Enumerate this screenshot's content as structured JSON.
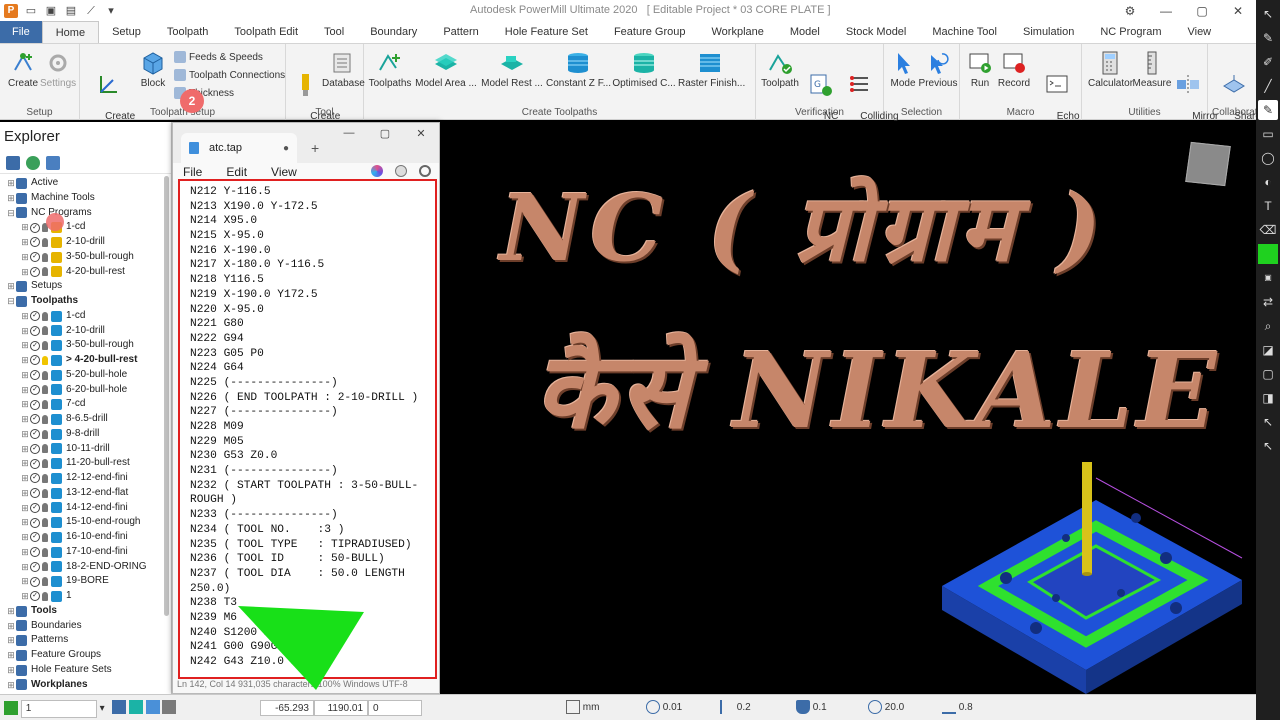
{
  "window": {
    "title": "Autodesk PowerMill Ultimate 2020",
    "project": "[ Editable Project * 03 CORE PLATE ]"
  },
  "ribbon": {
    "tabs": [
      "File",
      "Home",
      "Setup",
      "Toolpath",
      "Toolpath Edit",
      "Tool",
      "Boundary",
      "Pattern",
      "Hole Feature Set",
      "Feature Group",
      "Workplane",
      "Model",
      "Stock Model",
      "Machine Tool",
      "Simulation",
      "NC Program",
      "View"
    ],
    "active_tab": "Home",
    "groups": {
      "setup": {
        "label": "Setup",
        "create": "Create",
        "settings": "Settings"
      },
      "toolpath_setup": {
        "label": "Toolpath setup",
        "create_workplane": "Create\nWorkplane",
        "block": "Block",
        "feeds_speeds": "Feeds & Speeds",
        "toolpath_connections": "Toolpath Connections",
        "thickness": "Thickness"
      },
      "tool": {
        "label": "Tool",
        "create_tool": "Create\nTool",
        "database": "Database"
      },
      "create_toolpaths": {
        "label": "Create Toolpaths",
        "toolpaths": "Toolpaths",
        "model_area": "Model Area ...",
        "model_rest": "Model Rest ...",
        "constant_z": "Constant Z F...",
        "optimised": "Optimised C...",
        "raster_finish": "Raster Finish..."
      },
      "verification": {
        "label": "Verification",
        "toolpath": "Toolpath",
        "nc_program": "NC\nProgram",
        "colliding_sections": "Colliding\nSections"
      },
      "selection": {
        "label": "Selection",
        "mode": "Mode",
        "previous": "Previous"
      },
      "macro": {
        "label": "Macro",
        "run": "Run",
        "record": "Record",
        "echo_commands": "Echo\nCommands"
      },
      "utilities": {
        "label": "Utilities",
        "calculator": "Calculator",
        "measure": "Measure",
        "mirror_project": "Mirror\nProject"
      },
      "collaborate": {
        "label": "Collaborate",
        "shared_views": "Shared\nViews"
      }
    }
  },
  "explorer": {
    "title": "Explorer",
    "tree": [
      {
        "label": "Active",
        "level": 0,
        "kind": "folder"
      },
      {
        "label": "Machine Tools",
        "level": 0,
        "kind": "folder"
      },
      {
        "label": "NC Programs",
        "level": 0,
        "kind": "folder",
        "expanded": true
      },
      {
        "label": "1-cd",
        "level": 1,
        "kind": "nc"
      },
      {
        "label": "2-10-drill",
        "level": 1,
        "kind": "nc"
      },
      {
        "label": "3-50-bull-rough",
        "level": 1,
        "kind": "nc"
      },
      {
        "label": "4-20-bull-rest",
        "level": 1,
        "kind": "nc"
      },
      {
        "label": "Setups",
        "level": 0,
        "kind": "folder"
      },
      {
        "label": "Toolpaths",
        "level": 0,
        "kind": "folder",
        "expanded": true,
        "bold": true
      },
      {
        "label": "1-cd",
        "level": 1,
        "kind": "tp"
      },
      {
        "label": "2-10-drill",
        "level": 1,
        "kind": "tp"
      },
      {
        "label": "3-50-bull-rough",
        "level": 1,
        "kind": "tp"
      },
      {
        "label": "> 4-20-bull-rest",
        "level": 1,
        "kind": "tp",
        "bold": true,
        "lit": true
      },
      {
        "label": "5-20-bull-hole",
        "level": 1,
        "kind": "tp"
      },
      {
        "label": "6-20-bull-hole",
        "level": 1,
        "kind": "tp"
      },
      {
        "label": "7-cd",
        "level": 1,
        "kind": "tp"
      },
      {
        "label": "8-6.5-drill",
        "level": 1,
        "kind": "tp"
      },
      {
        "label": "9-8-drill",
        "level": 1,
        "kind": "tp"
      },
      {
        "label": "10-11-drill",
        "level": 1,
        "kind": "tp"
      },
      {
        "label": "11-20-bull-rest",
        "level": 1,
        "kind": "tp"
      },
      {
        "label": "12-12-end-fini",
        "level": 1,
        "kind": "tp"
      },
      {
        "label": "13-12-end-flat",
        "level": 1,
        "kind": "tp"
      },
      {
        "label": "14-12-end-fini",
        "level": 1,
        "kind": "tp"
      },
      {
        "label": "15-10-end-rough",
        "level": 1,
        "kind": "tp"
      },
      {
        "label": "16-10-end-fini",
        "level": 1,
        "kind": "tp"
      },
      {
        "label": "17-10-end-fini",
        "level": 1,
        "kind": "tp"
      },
      {
        "label": "18-2-END-ORING",
        "level": 1,
        "kind": "tp"
      },
      {
        "label": "19-BORE",
        "level": 1,
        "kind": "tp"
      },
      {
        "label": "1",
        "level": 1,
        "kind": "tp"
      },
      {
        "label": "Tools",
        "level": 0,
        "kind": "folder",
        "bold": true
      },
      {
        "label": "Boundaries",
        "level": 0,
        "kind": "folder"
      },
      {
        "label": "Patterns",
        "level": 0,
        "kind": "folder"
      },
      {
        "label": "Feature Groups",
        "level": 0,
        "kind": "folder"
      },
      {
        "label": "Hole Feature Sets",
        "level": 0,
        "kind": "folder"
      },
      {
        "label": "Workplanes",
        "level": 0,
        "kind": "folder",
        "bold": true
      }
    ]
  },
  "notepad": {
    "tab_title": "atc.tap",
    "menu": [
      "File",
      "Edit",
      "View"
    ],
    "badge": "2",
    "lines": [
      "N212 Y-116.5",
      "N213 X190.0 Y-172.5",
      "N214 X95.0",
      "N215 X-95.0",
      "N216 X-190.0",
      "N217 X-180.0 Y-116.5",
      "N218 Y116.5",
      "N219 X-190.0 Y172.5",
      "N220 X-95.0",
      "N221 G80",
      "N222 G94",
      "N223 G05 P0",
      "N224 G64",
      "N225 (---------------)",
      "N226 ( END TOOLPATH : 2-10-DRILL )",
      "N227 (---------------)",
      "N228 M09",
      "N229 M05",
      "N230 G53 Z0.0",
      "N231 (---------------)",
      "N232 ( START TOOLPATH : 3-50-BULL-",
      "ROUGH )",
      "N233 (---------------)",
      "N234 ( TOOL NO.    :3 )",
      "N235 ( TOOL TYPE   : TIPRADIUSED)",
      "N236 ( TOOL ID     : 50-BULL)",
      "N237 ( TOOL DIA    : 50.0 LENGTH",
      "250.0)",
      "N238 T3",
      "N239 M6",
      "N240 S1200 M03",
      "N241 G00 G90G0",
      "N242 G43 Z10.0 H3"
    ],
    "status": "Ln 142, Col 14   931,035 characters   100%   Windows   UTF-8"
  },
  "viewport": {
    "headline_line1": "NC ( प्रोग्राम )",
    "headline_line2": "कैसे NIKALE"
  },
  "statusbar": {
    "workplane": "1",
    "x": "-65.293",
    "y": "1190.01",
    "z": "0",
    "units": "mm",
    "tolerance": "0.01",
    "thickness": "0.2",
    "tool_offset": "0.1",
    "diameter": "20.0",
    "stepover": "0.8"
  },
  "colors": {
    "accent": "#3c6ca8",
    "headline": "#c6866a",
    "highlight_box": "#e02020",
    "arrow": "#18e018",
    "model_blue": "#1a4fd6",
    "model_green": "#33e633"
  }
}
